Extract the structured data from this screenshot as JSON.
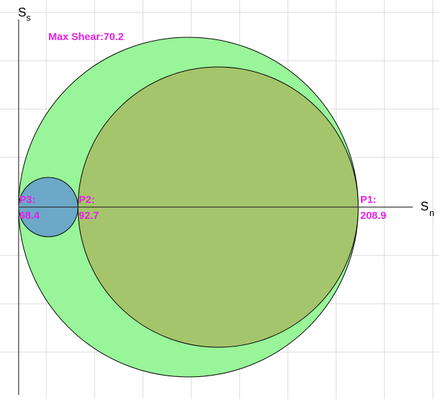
{
  "axes": {
    "vertical_label": "S",
    "vertical_subscript": "s",
    "horizontal_label": "S",
    "horizontal_subscript": "n"
  },
  "max_shear": {
    "text": "Max Shear:70.2",
    "value": 70.2
  },
  "principal_stresses": [
    {
      "name": "P1:",
      "value": "208.9"
    },
    {
      "name": "P2:",
      "value": "92.7"
    },
    {
      "name": "P3:",
      "value": "68.4"
    }
  ],
  "circles": [
    {
      "id": "outer",
      "from": "P3",
      "to": "P1",
      "fill": "#99f599"
    },
    {
      "id": "p2-p1",
      "from": "P2",
      "to": "P1",
      "fill": "#a5c56c"
    },
    {
      "id": "p3-p2",
      "from": "P3",
      "to": "P2",
      "fill": "#6ca8c8"
    }
  ],
  "colors": {
    "label": "#e81ee8",
    "grid": "#d9d9d9",
    "outline": "#000000"
  }
}
